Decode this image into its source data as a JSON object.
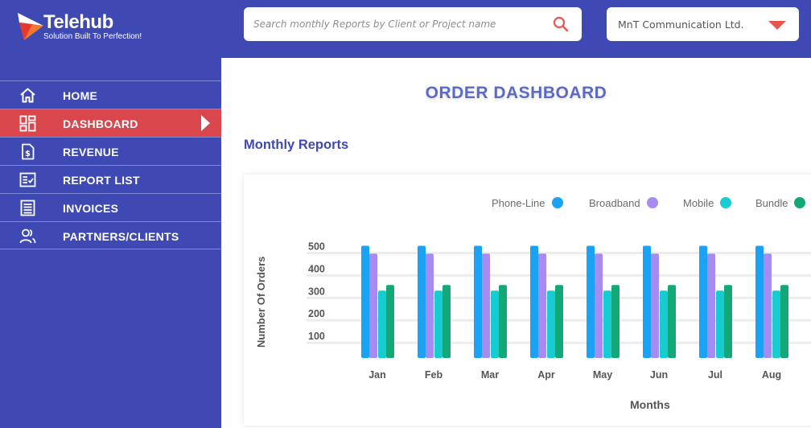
{
  "app": {
    "name": "Telehub",
    "tagline": "Solution Built To Perfection!"
  },
  "search": {
    "placeholder": "Search monthly Reports by Client or Project name",
    "icon": "search-icon"
  },
  "client_select": {
    "value": "MnT Communication Ltd."
  },
  "sidebar": {
    "items": [
      {
        "label": "HOME",
        "icon": "home-icon",
        "active": false
      },
      {
        "label": "DASHBOARD",
        "icon": "dashboard-icon",
        "active": true
      },
      {
        "label": "REVENUE",
        "icon": "revenue-icon",
        "active": false
      },
      {
        "label": "REPORT LIST",
        "icon": "report-list-icon",
        "active": false
      },
      {
        "label": "INVOICES",
        "icon": "invoices-icon",
        "active": false
      },
      {
        "label": "PARTNERS/CLIENTS",
        "icon": "partners-icon",
        "active": false
      }
    ]
  },
  "main": {
    "title": "ORDER DASHBOARD",
    "section_title": "Monthly Reports"
  },
  "colors": {
    "brand": "#3f49b3",
    "accent": "#d9474c",
    "title": "#5d6ac4",
    "phone_line": "#1aa3f5",
    "broadband": "#a78bf0",
    "mobile": "#17ccd0",
    "bundle": "#13a878"
  },
  "chart_data": {
    "type": "bar",
    "title": "",
    "xlabel": "Months",
    "ylabel": "Number Of Orders",
    "categories": [
      "Jan",
      "Feb",
      "Mar",
      "Apr",
      "May",
      "Jun",
      "Jul",
      "Aug"
    ],
    "yticks": [
      100,
      200,
      300,
      400,
      500
    ],
    "ylim": [
      0,
      540
    ],
    "grid": true,
    "legend_position": "top-right",
    "series": [
      {
        "name": "Phone-Line",
        "color": "#1aa3f5",
        "values": [
          500,
          500,
          500,
          500,
          500,
          500,
          500,
          500
        ]
      },
      {
        "name": "Broadband",
        "color": "#a78bf0",
        "values": [
          465,
          465,
          465,
          465,
          465,
          465,
          465,
          465
        ]
      },
      {
        "name": "Mobile",
        "color": "#17ccd0",
        "values": [
          300,
          300,
          300,
          300,
          300,
          300,
          300,
          300
        ]
      },
      {
        "name": "Bundle",
        "color": "#13a878",
        "values": [
          325,
          325,
          325,
          325,
          325,
          325,
          325,
          325
        ]
      }
    ]
  }
}
